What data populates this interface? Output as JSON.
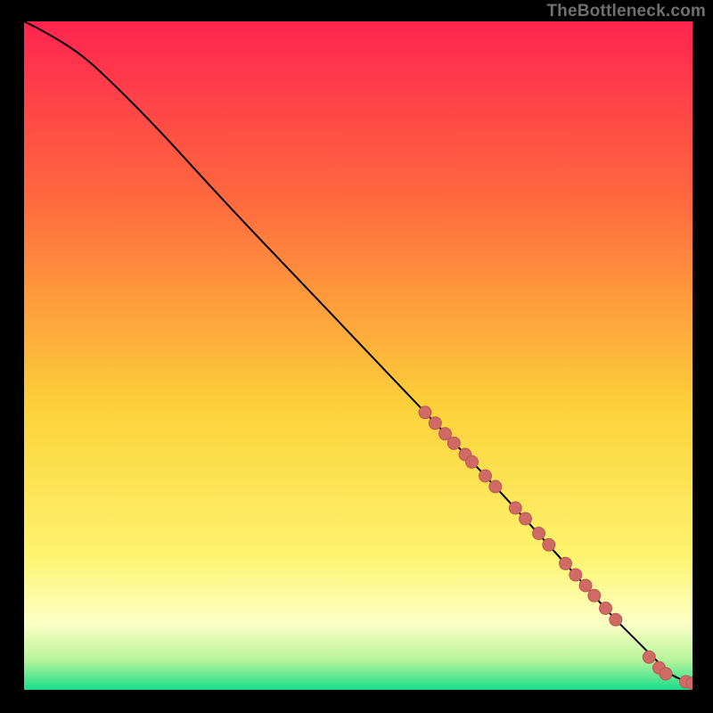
{
  "watermark": "TheBottleneck.com",
  "colors": {
    "background_black": "#000000",
    "gradient_top": "#ff2450",
    "gradient_upper": "#ff6a3e",
    "gradient_mid": "#fcd23a",
    "gradient_lower_yellow": "#fdf46e",
    "gradient_pale_band": "#fcffc5",
    "gradient_green_top": "#b9f49d",
    "gradient_green_bottom": "#18dd8a",
    "curve": "#000000",
    "dot_fill": "#cf6a64",
    "dot_stroke": "#b85953"
  },
  "chart_data": {
    "type": "line",
    "title": "",
    "xlabel": "",
    "ylabel": "",
    "xlim": [
      0,
      100
    ],
    "ylim": [
      0,
      100
    ],
    "series": [
      {
        "name": "curve",
        "x": [
          0,
          3,
          8,
          12,
          20,
          30,
          40,
          50,
          60,
          70,
          80,
          88,
          90,
          93,
          95,
          97,
          100
        ],
        "y": [
          100,
          98.5,
          95.5,
          92,
          84,
          73,
          62.5,
          52,
          41.5,
          31,
          20,
          11,
          9,
          6,
          4,
          2,
          1
        ]
      }
    ],
    "dots": {
      "name": "highlighted-points",
      "points": [
        {
          "x": 60.0,
          "y": 41.5
        },
        {
          "x": 61.5,
          "y": 39.9
        },
        {
          "x": 63.0,
          "y": 38.3
        },
        {
          "x": 64.3,
          "y": 36.9
        },
        {
          "x": 66.0,
          "y": 35.2
        },
        {
          "x": 67.0,
          "y": 34.1
        },
        {
          "x": 69.0,
          "y": 32.0
        },
        {
          "x": 70.5,
          "y": 30.4
        },
        {
          "x": 73.5,
          "y": 27.2
        },
        {
          "x": 75.0,
          "y": 25.6
        },
        {
          "x": 77.0,
          "y": 23.4
        },
        {
          "x": 78.5,
          "y": 21.7
        },
        {
          "x": 81.0,
          "y": 18.9
        },
        {
          "x": 82.5,
          "y": 17.2
        },
        {
          "x": 84.0,
          "y": 15.6
        },
        {
          "x": 85.3,
          "y": 14.1
        },
        {
          "x": 87.0,
          "y": 12.2
        },
        {
          "x": 88.5,
          "y": 10.5
        },
        {
          "x": 93.5,
          "y": 4.9
        },
        {
          "x": 95.0,
          "y": 3.3
        },
        {
          "x": 96.0,
          "y": 2.4
        },
        {
          "x": 99.0,
          "y": 1.2
        },
        {
          "x": 100.0,
          "y": 1.0
        }
      ]
    }
  }
}
